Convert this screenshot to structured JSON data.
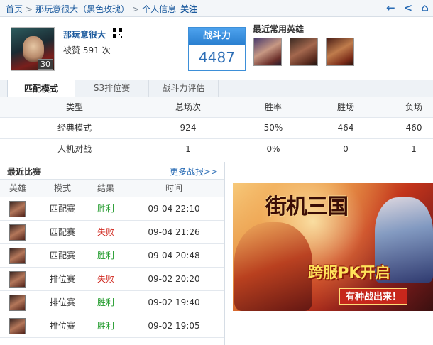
{
  "breadcrumb": {
    "home": "首页",
    "player": "那玩意很大（黑色玫瑰）",
    "page": "个人信息",
    "follow": "关注"
  },
  "toolbar_icons": [
    "back-arrow-icon",
    "share-icon",
    "home-icon"
  ],
  "profile": {
    "name": "那玩意很大",
    "level": "30",
    "likes_label": "被赞",
    "likes_count": "591",
    "likes_unit": "次",
    "power_label": "战斗力",
    "power_value": "4487",
    "fav_heroes_title": "最近常用英雄"
  },
  "tabs": [
    {
      "label": "匹配模式",
      "active": true
    },
    {
      "label": "S3排位赛",
      "active": false
    },
    {
      "label": "战斗力评估",
      "active": false
    }
  ],
  "stats": {
    "headers": [
      "类型",
      "总场次",
      "胜率",
      "胜场",
      "负场"
    ],
    "rows": [
      [
        "经典模式",
        "924",
        "50%",
        "464",
        "460"
      ],
      [
        "人机对战",
        "1",
        "0%",
        "0",
        "1"
      ]
    ]
  },
  "recent": {
    "title": "最近比赛",
    "more": "更多战报>>",
    "headers": [
      "英雄",
      "模式",
      "结果",
      "时间"
    ],
    "rows": [
      {
        "mode": "匹配赛",
        "result": "胜利",
        "time": "09-04 22:10"
      },
      {
        "mode": "匹配赛",
        "result": "失败",
        "time": "09-04 21:26"
      },
      {
        "mode": "匹配赛",
        "result": "胜利",
        "time": "09-04 20:48"
      },
      {
        "mode": "排位赛",
        "result": "失败",
        "time": "09-02 20:20"
      },
      {
        "mode": "排位赛",
        "result": "胜利",
        "time": "09-02 19:40"
      },
      {
        "mode": "排位赛",
        "result": "胜利",
        "time": "09-02 19:05"
      }
    ]
  },
  "ad": {
    "game_title": "街机三国",
    "slogan": "跨服PK开启",
    "cta": "有种战出来！"
  },
  "colors": {
    "link": "#1d5b9e",
    "win": "#1f9a2a",
    "lose": "#d0281f",
    "power_header": "#2a7fd0"
  }
}
